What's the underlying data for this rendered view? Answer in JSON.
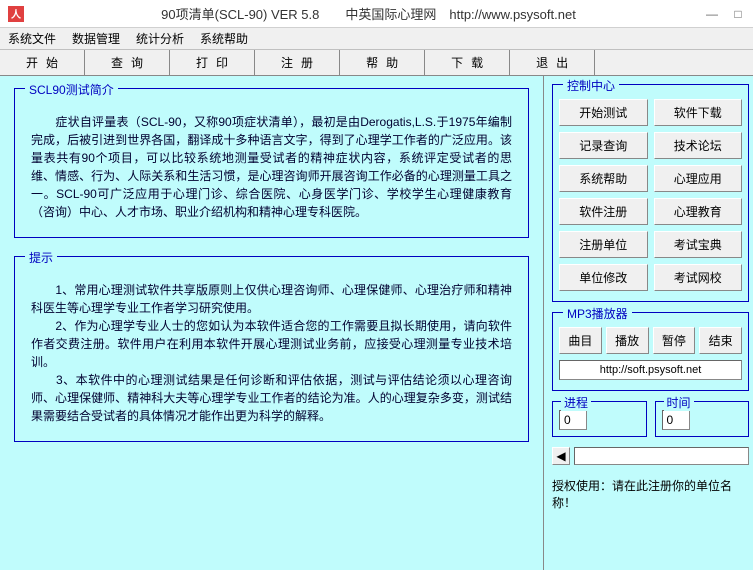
{
  "title": "90项清单(SCL-90) VER 5.8　　中英国际心理网　http://www.psysoft.net",
  "window": {
    "min": "—",
    "max": "□",
    "close": ""
  },
  "menu": [
    "系统文件",
    "数据管理",
    "统计分析",
    "系统帮助"
  ],
  "toolbar": [
    "开始",
    "查询",
    "打印",
    "注册",
    "帮助",
    "下载",
    "退出"
  ],
  "intro": {
    "legend": "SCL90测试简介",
    "text": "　　症状自评量表（SCL-90，又称90项症状清单），最初是由Derogatis,L.S.于1975年编制完成，后被引进到世界各国，翻译成十多种语言文字，得到了心理学工作者的广泛应用。该量表共有90个项目，可以比较系统地测量受试者的精神症状内容，系统评定受试者的思维、情感、行为、人际关系和生活习惯，是心理咨询师开展咨询工作必备的心理测量工具之一。SCL-90可广泛应用于心理门诊、综合医院、心身医学门诊、学校学生心理健康教育（咨询）中心、人才市场、职业介绍机构和精神心理专科医院。"
  },
  "tip": {
    "legend": "提示",
    "text": "　　1、常用心理测试软件共享版原则上仅供心理咨询师、心理保健师、心理治疗师和精神科医生等心理学专业工作者学习研究使用。\n　　2、作为心理学专业人士的您如认为本软件适合您的工作需要且拟长期使用，请向软件作者交费注册。软件用户在利用本软件开展心理测试业务前，应接受心理测量专业技术培训。\n　　3、本软件中的心理测试结果是任何诊断和评估依据，测试与评估结论须以心理咨询师、心理保健师、精神科大夫等心理学专业工作者的结论为准。人的心理复杂多变，测试结果需要结合受试者的具体情况才能作出更为科学的解释。"
  },
  "control": {
    "legend": "控制中心",
    "buttons": [
      [
        "开始测试",
        "软件下载"
      ],
      [
        "记录查询",
        "技术论坛"
      ],
      [
        "系统帮助",
        "心理应用"
      ],
      [
        "软件注册",
        "心理教育"
      ],
      [
        "注册单位",
        "考试宝典"
      ],
      [
        "单位修改",
        "考试网校"
      ]
    ]
  },
  "mp3": {
    "legend": "MP3播放器",
    "buttons": [
      "曲目",
      "播放",
      "暂停",
      "结束"
    ],
    "url": "http://soft.psysoft.net"
  },
  "progress": {
    "legend": "进程",
    "value": "0"
  },
  "time": {
    "legend": "时间",
    "value": "0"
  },
  "scroll_arrow": "◀",
  "auth": "授权使用：请在此注册你的单位名称！"
}
